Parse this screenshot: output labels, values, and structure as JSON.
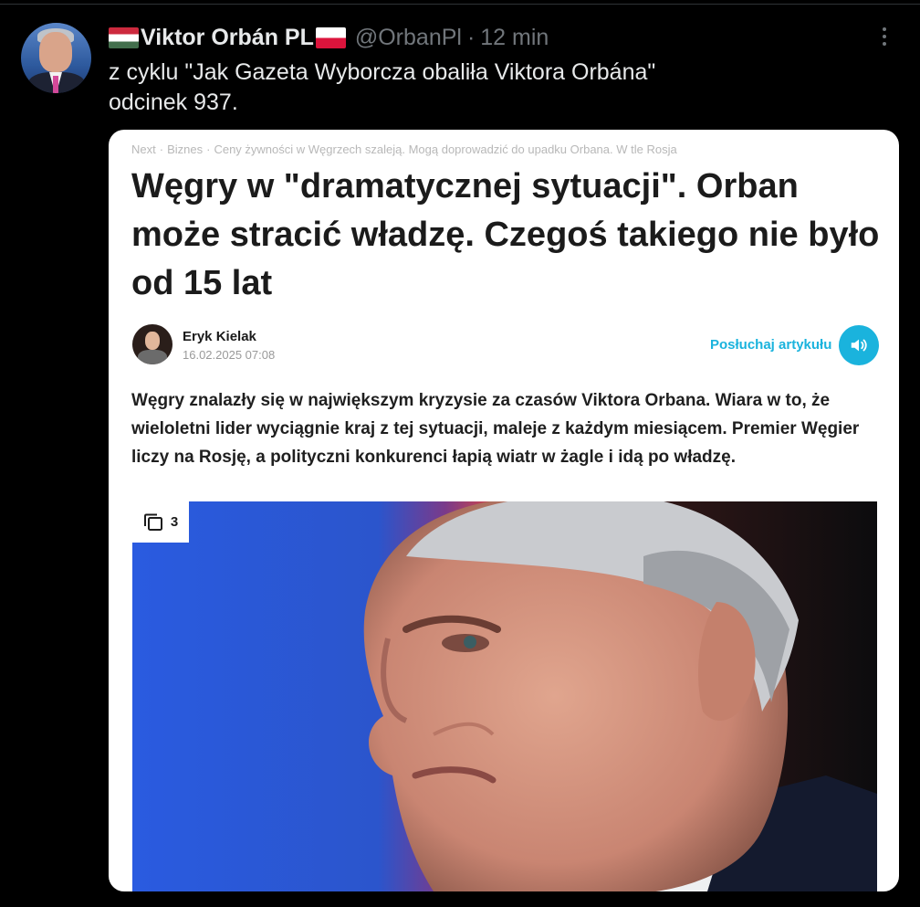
{
  "tweet": {
    "author_name": "Viktor Orbán PL",
    "handle": "@OrbanPl",
    "separator": "·",
    "time": "12 min",
    "text_line1": "z cyklu \"Jak Gazeta Wyborcza obaliła Viktora Orbána\"",
    "text_line2": "odcinek 937."
  },
  "article": {
    "breadcrumb": [
      "Next",
      "Biznes",
      "Ceny żywności w Węgrzech szaleją. Mogą doprowadzić do upadku Orbana. W tle Rosja"
    ],
    "breadcrumb_separator": "·",
    "headline": "Węgry w \"dramatycznej sytuacji\". Orban może stracić władzę. Czegoś takiego nie było od 15 lat",
    "author": "Eryk Kielak",
    "date": "16.02.2025 07:08",
    "listen_label": "Posłuchaj artykułu",
    "lead": "Węgry znalazły się w największym kryzysie za czasów Viktora Orbana. Wiara w to, że wieloletni lider wyciągnie kraj z tej sytuacji, maleje z każdym miesiącem. Premier Węgier liczy na Rosję, a polityczni konkurenci łapią wiatr w żagle i idą po władzę.",
    "photo_count": "3"
  },
  "colors": {
    "background": "#000000",
    "card": "#ffffff",
    "accent": "#1ab3dd",
    "muted": "#71767b",
    "photo_background": "#2b5bd6"
  },
  "icons": [
    "flag-hungary-icon",
    "flag-poland-icon",
    "more-options-icon",
    "speaker-icon",
    "gallery-icon"
  ]
}
